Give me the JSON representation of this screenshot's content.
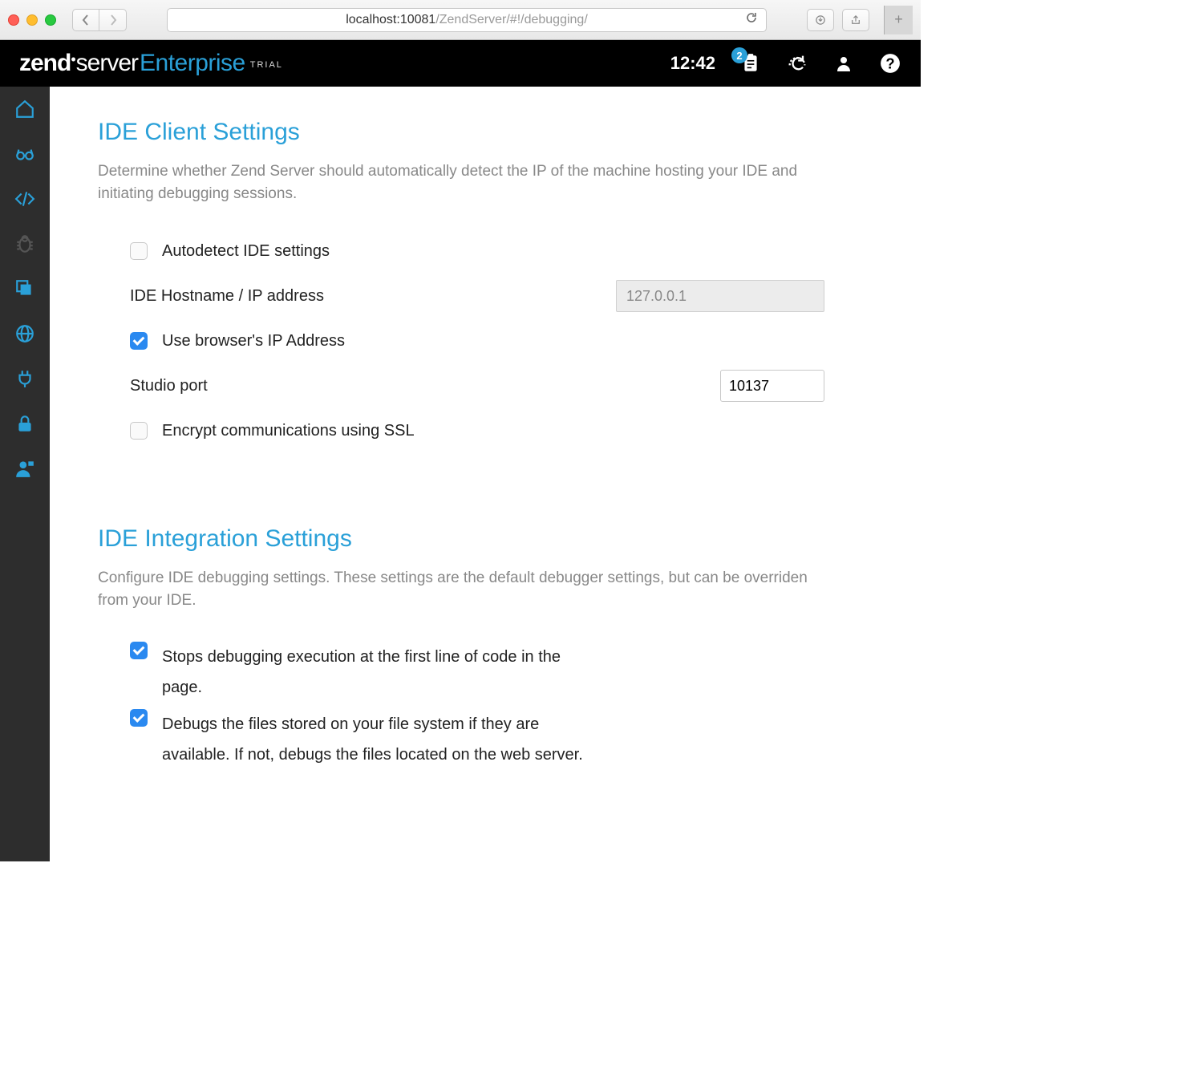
{
  "browser": {
    "url_host": "localhost:10081",
    "url_path": "/ZendServer/#!/debugging/"
  },
  "header": {
    "brand_zend": "zend",
    "brand_server": "server",
    "brand_enterprise": "Enterprise",
    "brand_trial": "TRIAL",
    "clock": "12:42",
    "notif_count": "2"
  },
  "sections": {
    "client": {
      "title": "IDE Client Settings",
      "desc": "Determine whether Zend Server should automatically detect the IP of the machine hosting your IDE and initiating debugging sessions.",
      "autodetect_label": "Autodetect IDE settings",
      "hostname_label": "IDE Hostname / IP address",
      "hostname_value": "127.0.0.1",
      "use_browser_ip_label": "Use browser's IP Address",
      "studio_port_label": "Studio port",
      "studio_port_value": "10137",
      "encrypt_label": "Encrypt communications using SSL"
    },
    "integration": {
      "title": "IDE Integration Settings",
      "desc": "Configure IDE debugging settings. These settings are the default debugger settings, but can be overriden from your IDE.",
      "stop_first_line_label": "Stops debugging execution at the first line of code in the page.",
      "debug_local_files_label": "Debugs the files stored on your file system if they are available. If not, debugs the files located on the web server."
    }
  }
}
